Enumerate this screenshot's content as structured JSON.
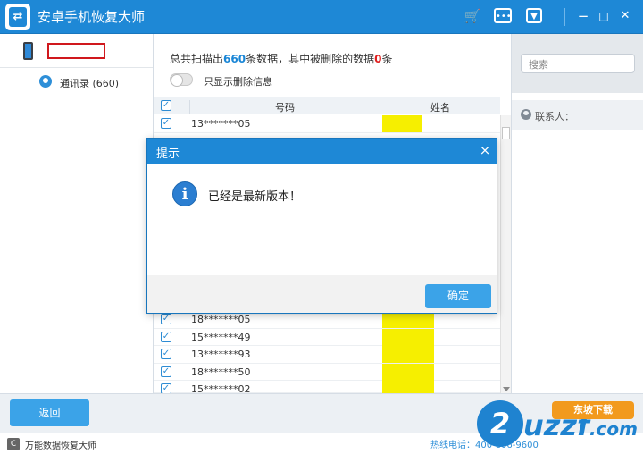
{
  "app": {
    "title": "安卓手机恢复大师"
  },
  "titlebar": {
    "cart_icon": "cart-icon",
    "chat_icon": "chat-icon",
    "menu_icon": "dropdown-menu-icon",
    "minimize": "−",
    "maximize": "□",
    "close": "✕"
  },
  "sidebar": {
    "contacts_label": "通讯录 (660)"
  },
  "summary": {
    "prefix": "总共扫描出",
    "total": "660",
    "middle": "条数据，其中被删除的数据",
    "deleted": "0",
    "suffix": "条"
  },
  "toggle": {
    "label": "只显示删除信息"
  },
  "table": {
    "columns": [
      "号码",
      "姓名"
    ],
    "rows": [
      {
        "number": "13*******05",
        "checked": true
      },
      {
        "number": "18*******05",
        "checked": true
      },
      {
        "number": "15*******49",
        "checked": true
      },
      {
        "number": "13*******93",
        "checked": true
      },
      {
        "number": "18*******50",
        "checked": true
      },
      {
        "number": "15*******02",
        "checked": true
      }
    ]
  },
  "right": {
    "search_placeholder": "搜索",
    "contact_label": "联系人："
  },
  "footer": {
    "back_label": "返回",
    "status_app": "万能数据恢复大师",
    "hotline": "热线电话：400-806-9600"
  },
  "watermark": {
    "z": "2",
    "text": "uzzf",
    "domain_suffix": ".com",
    "tag": "东坡下载"
  },
  "dialog": {
    "title": "提示",
    "message": "已经是最新版本！",
    "ok_label": "确定",
    "close": "×"
  },
  "colors": {
    "accent": "#1e88d6",
    "button": "#3ba3e8",
    "highlight": "#f6ef00",
    "red": "#e02020"
  }
}
